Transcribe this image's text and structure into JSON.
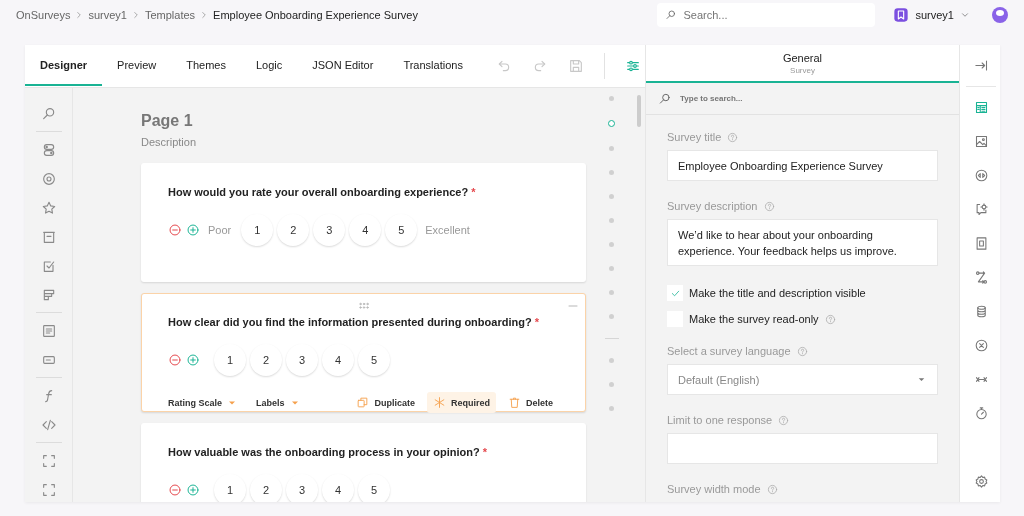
{
  "breadcrumbs": [
    {
      "label": "OnSurveys",
      "selected": false
    },
    {
      "label": "survey1",
      "selected": false
    },
    {
      "label": "Templates",
      "selected": false
    },
    {
      "label": "Employee Onboarding Experience Survey",
      "selected": true
    }
  ],
  "search": {
    "placeholder": "Search..."
  },
  "workspace": {
    "name": "survey1"
  },
  "tabs": [
    {
      "label": "Designer",
      "selected": true
    },
    {
      "label": "Preview",
      "selected": false
    },
    {
      "label": "Themes",
      "selected": false
    },
    {
      "label": "Logic",
      "selected": false
    },
    {
      "label": "JSON Editor",
      "selected": false
    },
    {
      "label": "Translations",
      "selected": false
    }
  ],
  "toolbar": [
    {
      "kind": "undo",
      "disabled": true
    },
    {
      "kind": "redo",
      "disabled": true
    },
    {
      "kind": "save",
      "disabled": true
    },
    {
      "kind": "settings",
      "disabled": false
    }
  ],
  "toolbox": [
    {
      "items": [
        {
          "kind": "search"
        }
      ]
    },
    {
      "items": [
        {
          "kind": "toggle"
        },
        {
          "kind": "radio"
        },
        {
          "kind": "star"
        },
        {
          "kind": "dropdown"
        },
        {
          "kind": "checkbox"
        },
        {
          "kind": "ranking"
        }
      ]
    },
    {
      "items": [
        {
          "kind": "comment"
        },
        {
          "kind": "text"
        }
      ]
    },
    {
      "items": [
        {
          "kind": "expression"
        },
        {
          "kind": "html"
        }
      ]
    },
    {
      "items": [
        {
          "kind": "panel"
        },
        {
          "kind": "panel"
        }
      ]
    }
  ],
  "page": {
    "title": "Page 1",
    "description": "Description"
  },
  "questions": [
    {
      "title": "How would you rate your overall onboarding experience?",
      "required_mark": "*",
      "selected": false,
      "min_label": "Poor",
      "max_label": "Excellent",
      "scale": [
        "1",
        "2",
        "3",
        "4",
        "5"
      ]
    },
    {
      "title": "How clear did you find the information presented during onboarding?",
      "required_mark": "*",
      "selected": true,
      "scale": [
        "1",
        "2",
        "3",
        "4",
        "5"
      ],
      "adorners": [
        "Rating Scale",
        "Labels"
      ],
      "actions": [
        {
          "kind": "duplicate",
          "label": "Duplicate",
          "active": false
        },
        {
          "kind": "required",
          "label": "Required",
          "active": true
        },
        {
          "kind": "delete",
          "label": "Delete",
          "active": false
        }
      ]
    },
    {
      "title": "How valuable was the onboarding process in your opinion?",
      "required_mark": "*",
      "selected": false,
      "scale": [
        "1",
        "2",
        "3",
        "4",
        "5"
      ]
    }
  ],
  "page_navigator": [
    {
      "kind": "dot",
      "selected": false
    },
    {
      "kind": "dot",
      "selected": true
    },
    {
      "kind": "dot",
      "selected": false
    },
    {
      "kind": "dot",
      "selected": false
    },
    {
      "kind": "dot",
      "selected": false
    },
    {
      "kind": "dot",
      "selected": false
    },
    {
      "kind": "dot",
      "selected": false
    },
    {
      "kind": "dot",
      "selected": false
    },
    {
      "kind": "dot",
      "selected": false
    },
    {
      "kind": "dot",
      "selected": false
    },
    {
      "kind": "divider"
    },
    {
      "kind": "dot",
      "selected": false
    },
    {
      "kind": "dot",
      "selected": false
    },
    {
      "kind": "dot",
      "selected": false
    }
  ],
  "properties": {
    "title": "General",
    "subtitle": "Survey",
    "search_placeholder": "Type to search...",
    "fields": [
      {
        "kind": "text",
        "label": "Survey title",
        "help": true,
        "value": "Employee Onboarding Experience Survey"
      },
      {
        "kind": "textarea",
        "label": "Survey description",
        "help": true,
        "value": "We’d like to hear about your onboarding experience. Your feedback helps us improve."
      },
      {
        "kind": "checkbox",
        "label": "Make the title and description visible",
        "help": false,
        "checked": true
      },
      {
        "kind": "checkbox",
        "label": "Make the survey read-only",
        "help": true,
        "checked": false
      },
      {
        "kind": "dropdown",
        "label": "Select a survey language",
        "help": true,
        "value": "Default (English)"
      },
      {
        "kind": "text",
        "label": "Limit to one response",
        "help": true
      },
      {
        "kind": "heading",
        "label": "Survey width mode",
        "help": true
      }
    ]
  },
  "sidebar": [
    {
      "kind": "collapse",
      "selected": false
    },
    {
      "kind": "general",
      "selected": true
    },
    {
      "kind": "image",
      "selected": false
    },
    {
      "kind": "logic",
      "selected": false
    },
    {
      "kind": "chat",
      "selected": false
    },
    {
      "kind": "document",
      "selected": false
    },
    {
      "kind": "route",
      "selected": false
    },
    {
      "kind": "database",
      "selected": false
    },
    {
      "kind": "cancel",
      "selected": false
    },
    {
      "kind": "arrows",
      "selected": false
    },
    {
      "kind": "timer",
      "selected": false
    },
    {
      "kind": "gear",
      "selected": false
    }
  ]
}
